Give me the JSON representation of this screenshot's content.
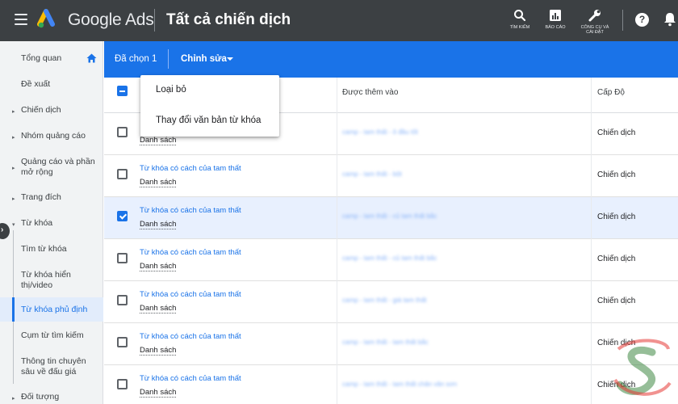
{
  "topbar": {
    "brand": "Google Ads",
    "page_title": "Tất cả chiến dịch",
    "tools": [
      {
        "icon": "search-icon",
        "label": "Tìm kiếm"
      },
      {
        "icon": "reports-icon",
        "label": "Báo cáo"
      },
      {
        "icon": "wrench-icon",
        "label_line1": "Công cụ và",
        "label_line2": "cài đặt"
      }
    ],
    "help_icon": "help-icon",
    "notification_icon": "bell-icon"
  },
  "sidebar": {
    "items": [
      {
        "label": "Tổng quan",
        "icon": "home-icon"
      },
      {
        "label": "Đề xuất"
      },
      {
        "label": "Chiến dịch",
        "arrow": "▸"
      },
      {
        "label": "Nhóm quảng cáo",
        "arrow": "▸"
      },
      {
        "label_line1": "Quảng cáo và phần",
        "label_line2": "mở rộng",
        "arrow": "▸"
      },
      {
        "label": "Trang đích",
        "arrow": "▸"
      },
      {
        "label": "Từ khóa",
        "arrow": "▾"
      },
      {
        "label": "Tìm từ khóa"
      },
      {
        "label_line1": "Từ khóa hiển",
        "label_line2": "thị/video"
      },
      {
        "label": "Từ khóa phủ định",
        "active": true
      },
      {
        "label": "Cụm từ tìm kiếm"
      },
      {
        "label_line1": "Thông tin chuyên",
        "label_line2": "sâu về đấu giá"
      },
      {
        "label": "Đối tượng",
        "arrow": "▸"
      }
    ]
  },
  "actionbar": {
    "selected_count": "Đã chọn 1",
    "edit_label": "Chỉnh sửa"
  },
  "menu": {
    "items": [
      "Loại bỏ",
      "Thay đổi văn bản từ khóa"
    ]
  },
  "table": {
    "headers": [
      "Được thêm vào",
      "Cấp Độ"
    ],
    "rows": [
      {
        "keyword": "",
        "list": "Danh sách",
        "added": "camp - tam thất - ô đầu tốt",
        "level": "Chiến dịch",
        "checked": false
      },
      {
        "keyword": "Từ khóa có cách của tam thất",
        "list": "Danh sách",
        "added": "camp - tam thất - bột",
        "level": "Chiến dịch",
        "checked": false
      },
      {
        "keyword": "Từ khóa có cách của tam thất",
        "list": "Danh sách",
        "added": "camp - tam thất - củ tam thất bắc",
        "level": "Chiến dịch",
        "checked": true
      },
      {
        "keyword": "Từ khóa có cách của tam thất",
        "list": "Danh sách",
        "added": "camp - tam thất - củ tam thất bắc",
        "level": "Chiến dịch",
        "checked": false
      },
      {
        "keyword": "Từ khóa có cách của tam thất",
        "list": "Danh sách",
        "added": "camp - tam thất - giá tam thất",
        "level": "Chiến dịch",
        "checked": false
      },
      {
        "keyword": "Từ khóa có cách của tam thất",
        "list": "Danh sách",
        "added": "camp - tam thất - tam thất bắc",
        "level": "Chiến dịch",
        "checked": false
      },
      {
        "keyword": "Từ khóa có cách của tam thất",
        "list": "Danh sách",
        "added": "camp - tam thất - tam thất chân văn sơn",
        "level": "Chiến dịch",
        "checked": false
      }
    ]
  },
  "colors": {
    "topbar": "#3c4043",
    "accent": "#1a73e8",
    "sidebar_bg": "#f1f3f4",
    "selected_row": "#e8f0fe"
  }
}
